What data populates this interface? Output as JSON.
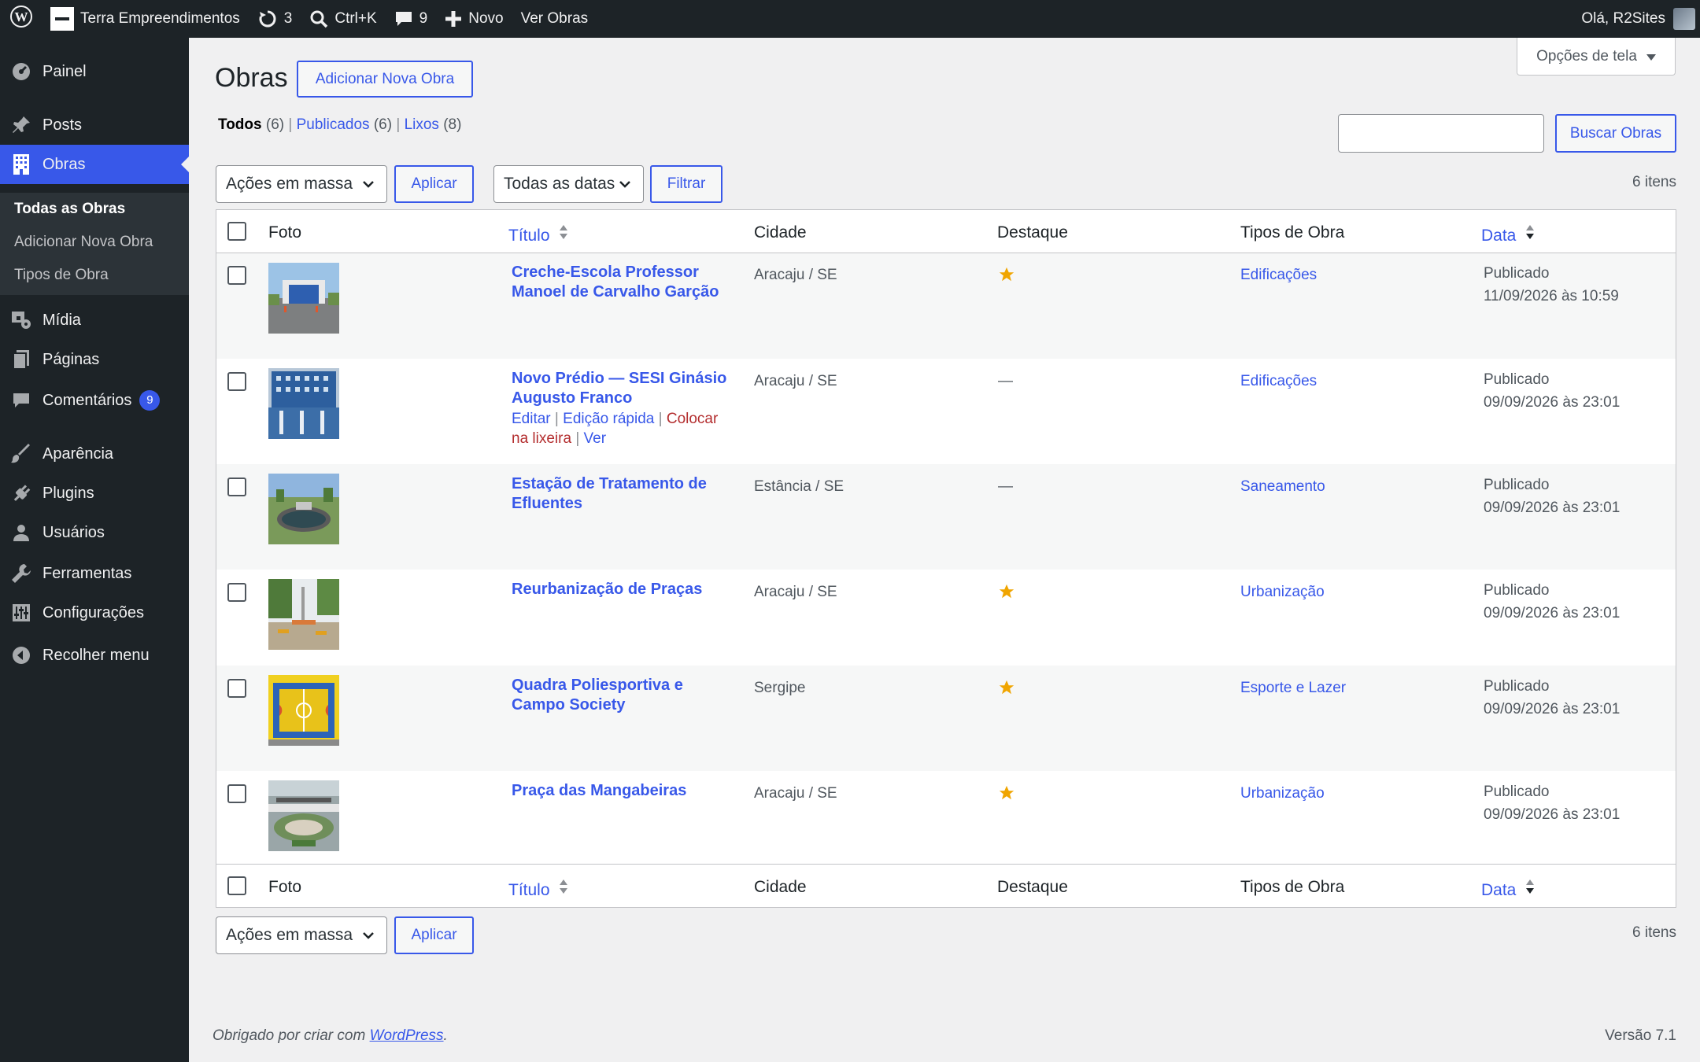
{
  "adminbar": {
    "site_name": "Terra Empreendimentos",
    "updates_count": "3",
    "search_shortcut": "Ctrl+K",
    "comments_count": "9",
    "new_label": "Novo",
    "view_label": "Ver Obras",
    "greeting": "Olá, R2Sites"
  },
  "sidebar": {
    "items": [
      {
        "label": "Painel",
        "icon": "dashboard-icon"
      },
      {
        "label": "Posts",
        "icon": "pin-icon"
      },
      {
        "label": "Obras",
        "icon": "building-icon"
      },
      {
        "label": "Mídia",
        "icon": "media-icon"
      },
      {
        "label": "Páginas",
        "icon": "pages-icon"
      },
      {
        "label": "Comentários",
        "icon": "comment-icon"
      },
      {
        "label": "Aparência",
        "icon": "brush-icon"
      },
      {
        "label": "Plugins",
        "icon": "plugin-icon"
      },
      {
        "label": "Usuários",
        "icon": "user-icon"
      },
      {
        "label": "Ferramentas",
        "icon": "wrench-icon"
      },
      {
        "label": "Configurações",
        "icon": "settings-icon"
      },
      {
        "label": "Recolher menu",
        "icon": "collapse-icon"
      }
    ],
    "comments_badge": "9",
    "submenu": [
      "Todas as Obras",
      "Adicionar Nova Obra",
      "Tipos de Obra"
    ]
  },
  "screen_options": "Opções de tela",
  "page": {
    "title": "Obras",
    "add_new": "Adicionar Nova Obra",
    "views": {
      "all": "Todos",
      "all_count": "(6)",
      "published": "Publicados",
      "published_count": "(6)",
      "trash": "Lixos",
      "trash_count": "(8)"
    },
    "search_button": "Buscar Obras",
    "bulk_actions": "Ações em massa",
    "apply": "Aplicar",
    "dates_filter": "Todas as datas",
    "filter": "Filtrar",
    "items_count": "6 itens"
  },
  "table": {
    "columns": {
      "photo": "Foto",
      "title": "Título",
      "city": "Cidade",
      "featured": "Destaque",
      "types": "Tipos de Obra",
      "date": "Data"
    },
    "row_actions": {
      "edit": "Editar",
      "quick_edit": "Edição rápida",
      "trash_1": "Colocar",
      "trash_2": "na lixeira",
      "view": "Ver"
    },
    "rows": [
      {
        "title_1": "Creche-Escola Professor",
        "title_2": "Manoel de Carvalho Garção",
        "city": "Aracaju / SE",
        "featured": true,
        "type": "Edificações",
        "status": "Publicado",
        "date": "11/09/2026 às 10:59"
      },
      {
        "title_1": "Novo Prédio — SESI Ginásio",
        "title_2": "Augusto Franco",
        "city": "Aracaju / SE",
        "featured": false,
        "featured_text": "—",
        "type": "Edificações",
        "status": "Publicado",
        "date": "09/09/2026 às 23:01"
      },
      {
        "title_1": "Estação de Tratamento de",
        "title_2": "Efluentes",
        "city": "Estância / SE",
        "featured": false,
        "featured_text": "—",
        "type": "Saneamento",
        "status": "Publicado",
        "date": "09/09/2026 às 23:01"
      },
      {
        "title_1": "Reurbanização de Praças",
        "title_2": "",
        "city": "Aracaju / SE",
        "featured": true,
        "type": "Urbanização",
        "status": "Publicado",
        "date": "09/09/2026 às 23:01"
      },
      {
        "title_1": "Quadra Poliesportiva e",
        "title_2": "Campo Society",
        "city": "Sergipe",
        "featured": true,
        "type": "Esporte e Lazer",
        "status": "Publicado",
        "date": "09/09/2026 às 23:01"
      },
      {
        "title_1": "Praça das Mangabeiras",
        "title_2": "",
        "city": "Aracaju / SE",
        "featured": true,
        "type": "Urbanização",
        "status": "Publicado",
        "date": "09/09/2026 às 23:01"
      }
    ]
  },
  "footer": {
    "thanks_prefix": "Obrigado por criar com ",
    "thanks_link": "WordPress",
    "thanks_suffix": ".",
    "version": "Versão 7.1"
  },
  "colors": {
    "accent": "#3858e9",
    "star": "#f0a500",
    "dark": "#1d2327"
  }
}
